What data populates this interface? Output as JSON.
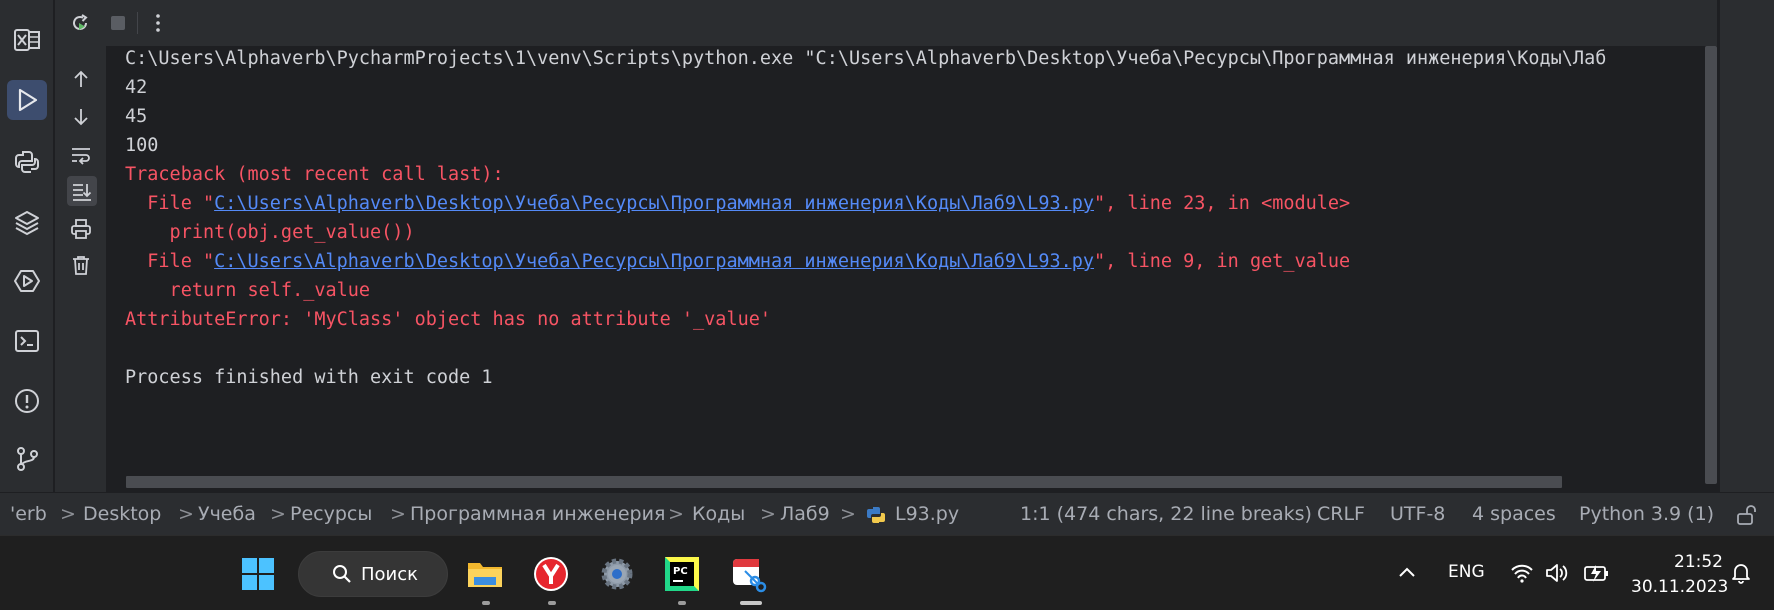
{
  "console": {
    "command": "C:\\Users\\Alphaverb\\PycharmProjects\\1\\venv\\Scripts\\python.exe \"C:\\Users\\Alphaverb\\Desktop\\Учеба\\Ресурсы\\Программная инженерия\\Коды\\Лаб",
    "output_lines": [
      "42",
      "45",
      "100"
    ],
    "traceback_header": "Traceback (most recent call last):",
    "frame1_prefix": "  File \"",
    "frame1_path": "C:\\Users\\Alphaverb\\Desktop\\Учеба\\Ресурсы\\Программная инженерия\\Коды\\Лаб9\\L93.py",
    "frame1_suffix": "\", line 23, in <module>",
    "frame1_code": "    print(obj.get_value())",
    "frame2_prefix": "  File \"",
    "frame2_path": "C:\\Users\\Alphaverb\\Desktop\\Учеба\\Ресурсы\\Программная инженерия\\Коды\\Лаб9\\L93.py",
    "frame2_suffix": "\", line 9, in get_value",
    "frame2_code": "    return self._value",
    "error": "AttributeError: 'MyClass' object has no attribute '_value'",
    "exit_message": "Process finished with exit code 1"
  },
  "statusbar": {
    "breadcrumbs": [
      "'erb",
      "Desktop",
      "Учеба",
      "Ресурсы",
      "Программная инженерия",
      "Коды",
      "Лаб9",
      "L93.py"
    ],
    "separator": ">",
    "position": "1:1 (474 chars, 22 line breaks)",
    "line_ending": "CRLF",
    "encoding": "UTF-8",
    "indent": "4 spaces",
    "interpreter": "Python 3.9 (1)"
  },
  "taskbar": {
    "search_label": "Поиск",
    "language": "ENG",
    "time": "21:52",
    "date": "30.11.2023"
  },
  "colors": {
    "error": "#f75464",
    "link": "#548af7",
    "text": "#cfd1d6",
    "background": "#1e1f22",
    "panel": "#2b2d30"
  }
}
